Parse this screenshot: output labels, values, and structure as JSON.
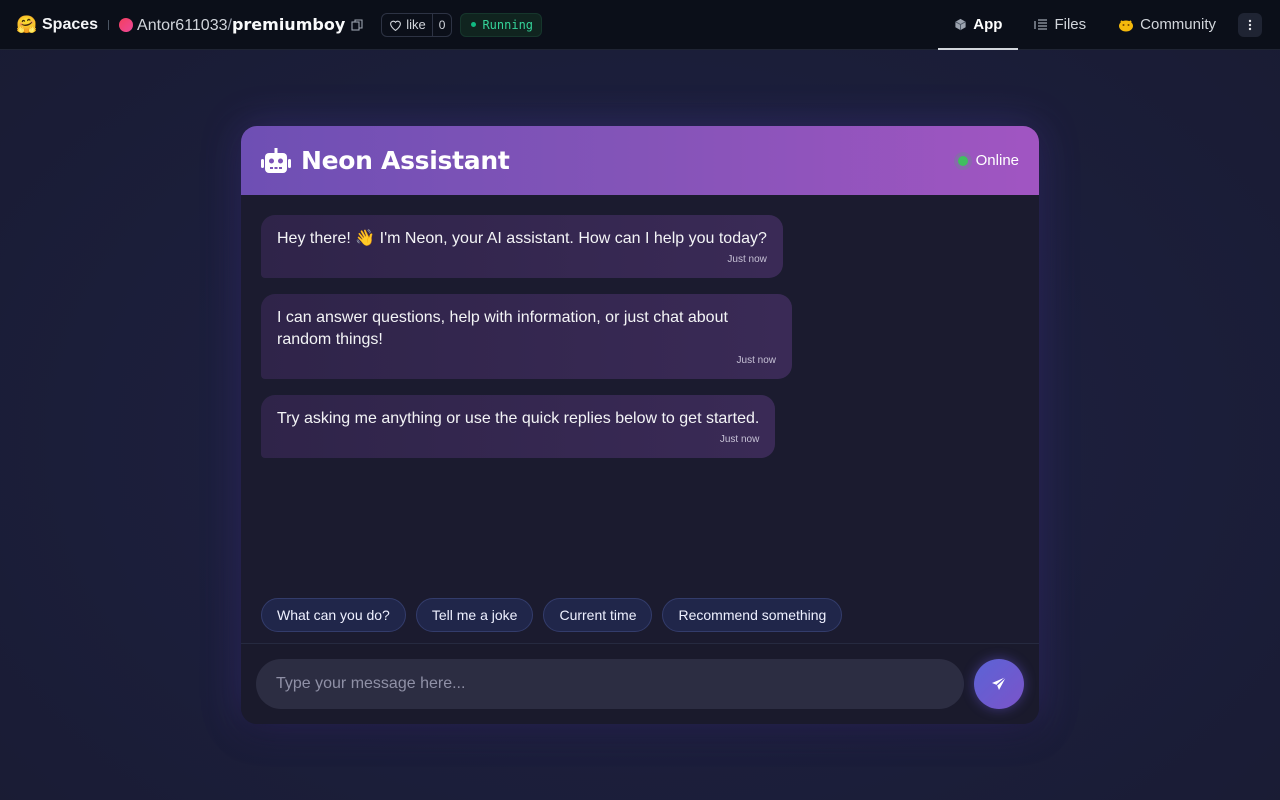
{
  "topbar": {
    "brand": "Spaces",
    "owner": "Antor611033",
    "slash": "/",
    "space_name": "premiumboy",
    "like_label": "like",
    "like_count": "0",
    "status": "Running",
    "nav": [
      {
        "label": "App",
        "icon": "cube-icon"
      },
      {
        "label": "Files",
        "icon": "files-icon"
      },
      {
        "label": "Community",
        "icon": "community-icon"
      }
    ]
  },
  "chat": {
    "title": "Neon Assistant",
    "status": "Online",
    "messages": [
      {
        "text": "Hey there! 👋 I'm Neon, your AI assistant. How can I help you today?",
        "time": "Just now"
      },
      {
        "text": "I can answer questions, help with information, or just chat about random things!",
        "time": "Just now"
      },
      {
        "text": "Try asking me anything or use the quick replies below to get started.",
        "time": "Just now"
      }
    ],
    "quick_replies": [
      "What can you do?",
      "Tell me a joke",
      "Current time",
      "Recommend something"
    ],
    "input_placeholder": "Type your message here..."
  },
  "colors": {
    "header_gradient_start": "#6e4fb4",
    "header_gradient_end": "#a155c2",
    "online_dot": "#3fbf5f",
    "running": "#34d399"
  }
}
